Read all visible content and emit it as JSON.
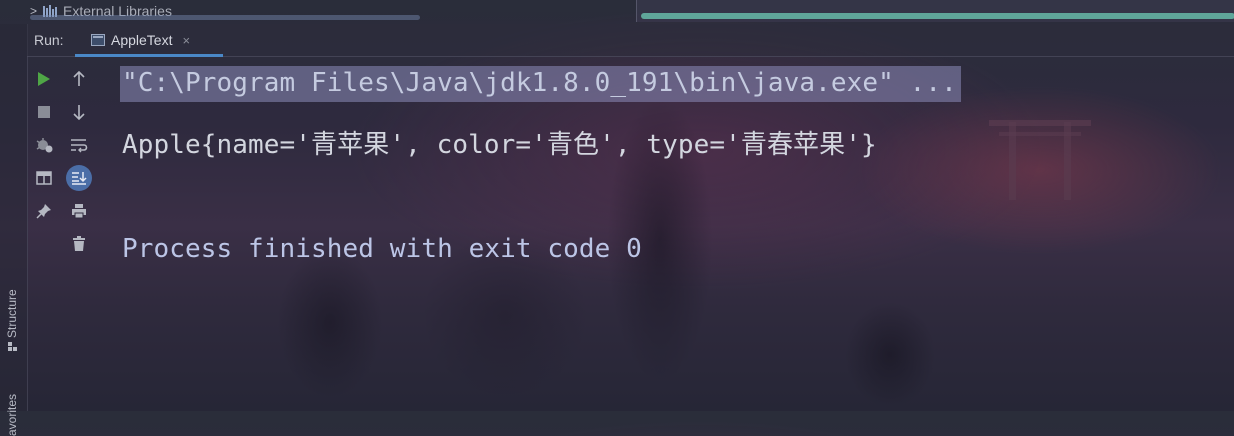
{
  "project_tree": {
    "external_libraries_label": "External Libraries"
  },
  "run_panel": {
    "run_label": "Run:",
    "tab_label": "AppleText",
    "close_glyph": "×"
  },
  "side_tabs": {
    "structure": "Structure",
    "favorites": "avorites"
  },
  "toolbar": {
    "left": [
      "run-icon",
      "stop-icon",
      "settings-bug-icon",
      "layout-icon",
      "pin-icon"
    ],
    "right": [
      "up-arrow-icon",
      "down-arrow-icon",
      "soft-wrap-icon",
      "scroll-to-end-icon",
      "print-icon",
      "trash-icon"
    ]
  },
  "console": {
    "command_line": "\"C:\\Program Files\\Java\\jdk1.8.0_191\\bin\\java.exe\" ...",
    "output_line": "Apple{name='青苹果', color='青色', type='青春苹果'}",
    "exit_line": "Process finished with exit code 0"
  },
  "colors": {
    "run_green": "#4fa646",
    "accent_blue": "#4a88c7",
    "selection": "#8c8cb9",
    "scrollbar_teal": "#5fa69a"
  }
}
